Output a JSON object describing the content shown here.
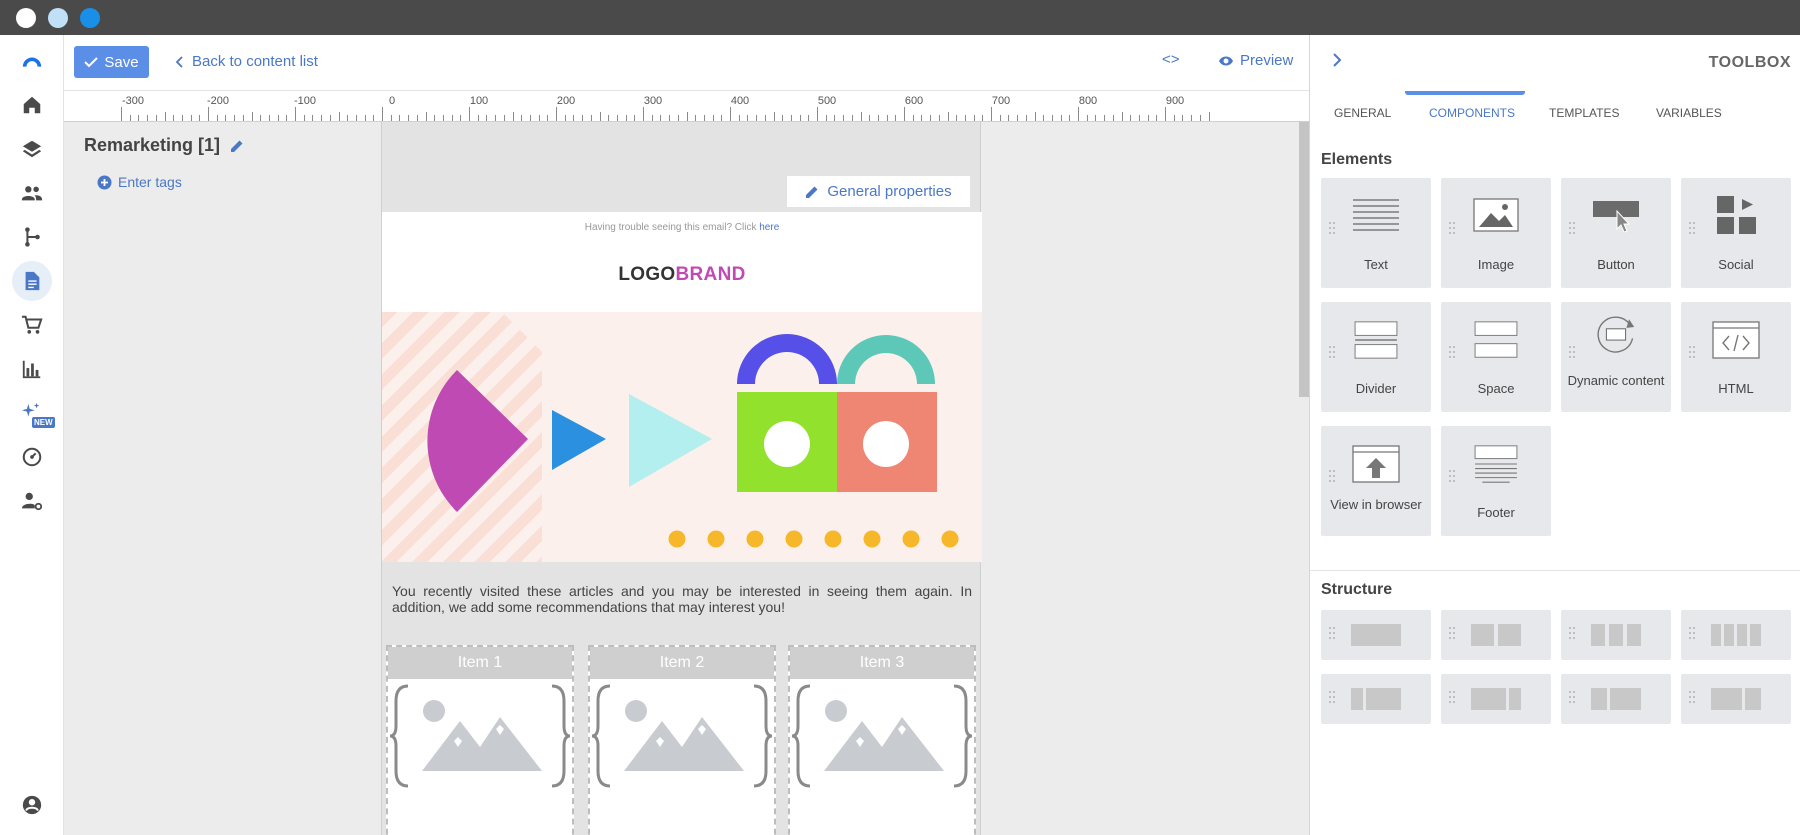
{
  "toolbar": {
    "save_label": "Save",
    "back_label": "Back to content list",
    "code_label": "<>",
    "preview_label": "Preview"
  },
  "document": {
    "title": "Remarketing [1]",
    "tags_label": "Enter tags"
  },
  "ruler": {
    "labels": [
      "-300",
      "-200",
      "-100",
      "0",
      "100",
      "200",
      "300",
      "400",
      "500",
      "600",
      "700",
      "800",
      "900"
    ]
  },
  "email": {
    "general_properties_label": "General properties",
    "trouble_text": "Having trouble seeing this email? Click",
    "trouble_link": "here",
    "logo_part1": "LOGO",
    "logo_part2": "BRAND",
    "intro_text": "You recently visited these articles and you may be interested in seeing them again. In addition, we add some recommendations that may interest you!",
    "items": [
      {
        "label": "Item 1"
      },
      {
        "label": "Item 2"
      },
      {
        "label": "Item 3"
      }
    ]
  },
  "toolbox": {
    "title": "TOOLBOX",
    "tabs": [
      {
        "label": "GENERAL",
        "active": false
      },
      {
        "label": "COMPONENTS",
        "active": true
      },
      {
        "label": "TEMPLATES",
        "active": false
      },
      {
        "label": "VARIABLES",
        "active": false
      }
    ],
    "elements_title": "Elements",
    "elements": [
      {
        "label": "Text",
        "icon": "text-icon"
      },
      {
        "label": "Image",
        "icon": "image-icon"
      },
      {
        "label": "Button",
        "icon": "button-icon"
      },
      {
        "label": "Social",
        "icon": "social-icon"
      },
      {
        "label": "Divider",
        "icon": "divider-icon"
      },
      {
        "label": "Space",
        "icon": "space-icon"
      },
      {
        "label": "Dynamic content",
        "icon": "dynamic-content-icon"
      },
      {
        "label": "HTML",
        "icon": "html-icon"
      },
      {
        "label": "View in browser",
        "icon": "view-in-browser-icon"
      },
      {
        "label": "Footer",
        "icon": "footer-icon"
      }
    ],
    "structure_title": "Structure"
  },
  "nav": {
    "new_badge": "NEW"
  },
  "colors": {
    "accent": "#5b8ee6",
    "link": "#4a78c6",
    "brand_magenta": "#c04ab4"
  }
}
